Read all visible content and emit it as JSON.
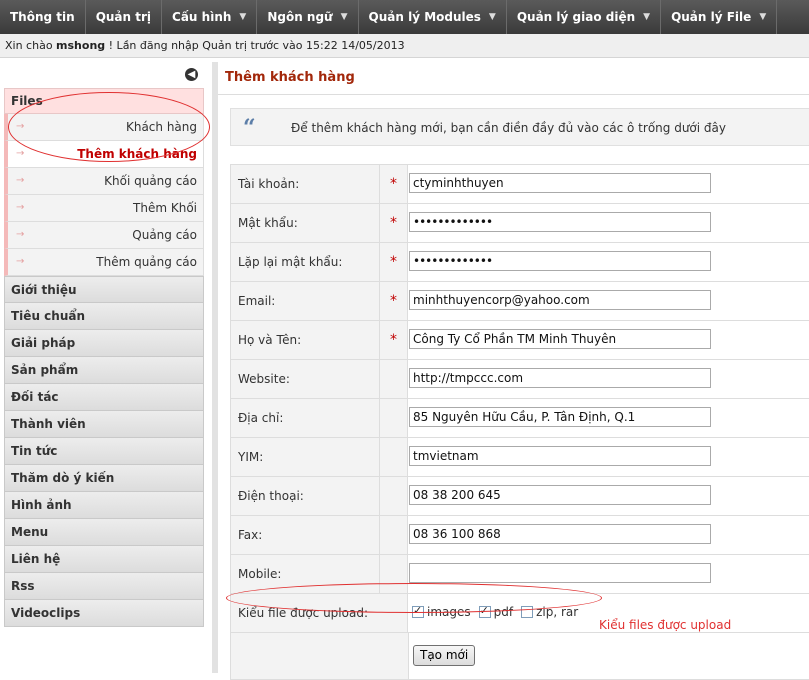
{
  "nav": [
    {
      "label": "Thông tin",
      "caret": false
    },
    {
      "label": "Quản trị",
      "caret": false
    },
    {
      "label": "Cấu hình",
      "caret": true
    },
    {
      "label": "Ngôn ngữ",
      "caret": true
    },
    {
      "label": "Quản lý Modules",
      "caret": true
    },
    {
      "label": "Quản lý giao diện",
      "caret": true
    },
    {
      "label": "Quản lý File",
      "caret": true
    }
  ],
  "greeting": {
    "prefix": "Xin chào ",
    "user": "mshong",
    "suffix": " ! Lần đăng nhập Quản trị trước vào 15:22 14/05/2013"
  },
  "sidebar": {
    "collapse_icon": "left-arrow-circle-icon",
    "files_label": "Files",
    "sub_items": [
      {
        "label": "Khách hàng",
        "active": false
      },
      {
        "label": "Thêm khách hàng",
        "active": true
      },
      {
        "label": "Khối quảng cáo",
        "active": false
      },
      {
        "label": "Thêm Khối",
        "active": false
      },
      {
        "label": "Quảng cáo",
        "active": false
      },
      {
        "label": "Thêm quảng cáo",
        "active": false
      }
    ],
    "sections": [
      "Giới thiệu",
      "Tiêu chuẩn",
      "Giải pháp",
      "Sản phẩm",
      "Đối tác",
      "Thành viên",
      "Tin tức",
      "Thăm dò ý kiến",
      "Hình ảnh",
      "Menu",
      "Liên hệ",
      "Rss",
      "Videoclips"
    ]
  },
  "main": {
    "title": "Thêm khách hàng",
    "quote_icon": "“",
    "notice": "Để thêm khách hàng mới, bạn cần điền đầy đủ vào các ô trống dưới đây",
    "required_mark": "*",
    "fields": [
      {
        "label": "Tài khoản:",
        "required": true,
        "value": "ctyminhthuyen",
        "type": "text"
      },
      {
        "label": "Mật khẩu:",
        "required": true,
        "value": "•••••••••••••",
        "type": "password"
      },
      {
        "label": "Lặp lại mật khẩu:",
        "required": true,
        "value": "•••••••••••••",
        "type": "password"
      },
      {
        "label": "Email:",
        "required": true,
        "value": "minhthuyencorp@yahoo.com",
        "type": "text"
      },
      {
        "label": "Họ và Tên:",
        "required": true,
        "value": "Công Ty Cổ Phần TM Minh Thuyên",
        "type": "text"
      },
      {
        "label": "Website:",
        "required": false,
        "value": "http://tmpccc.com",
        "type": "text"
      },
      {
        "label": "Địa chỉ:",
        "required": false,
        "value": "85 Nguyên Hữu Cầu, P. Tân Định, Q.1",
        "type": "text"
      },
      {
        "label": "YIM:",
        "required": false,
        "value": "tmvietnam",
        "type": "text"
      },
      {
        "label": "Điện thoại:",
        "required": false,
        "value": "08 38 200 645",
        "type": "text"
      },
      {
        "label": "Fax:",
        "required": false,
        "value": "08 36 100 868",
        "type": "text"
      },
      {
        "label": "Mobile:",
        "required": false,
        "value": "",
        "type": "text"
      }
    ],
    "upload": {
      "label": "Kiểu file được upload:",
      "options": [
        {
          "label": "images",
          "checked": true
        },
        {
          "label": "pdf",
          "checked": true
        },
        {
          "label": "zip, rar",
          "checked": false
        }
      ]
    },
    "submit_label": "Tạo mới"
  },
  "annotation": {
    "text": "Kiểu files được upload",
    "color": "#e03030"
  }
}
